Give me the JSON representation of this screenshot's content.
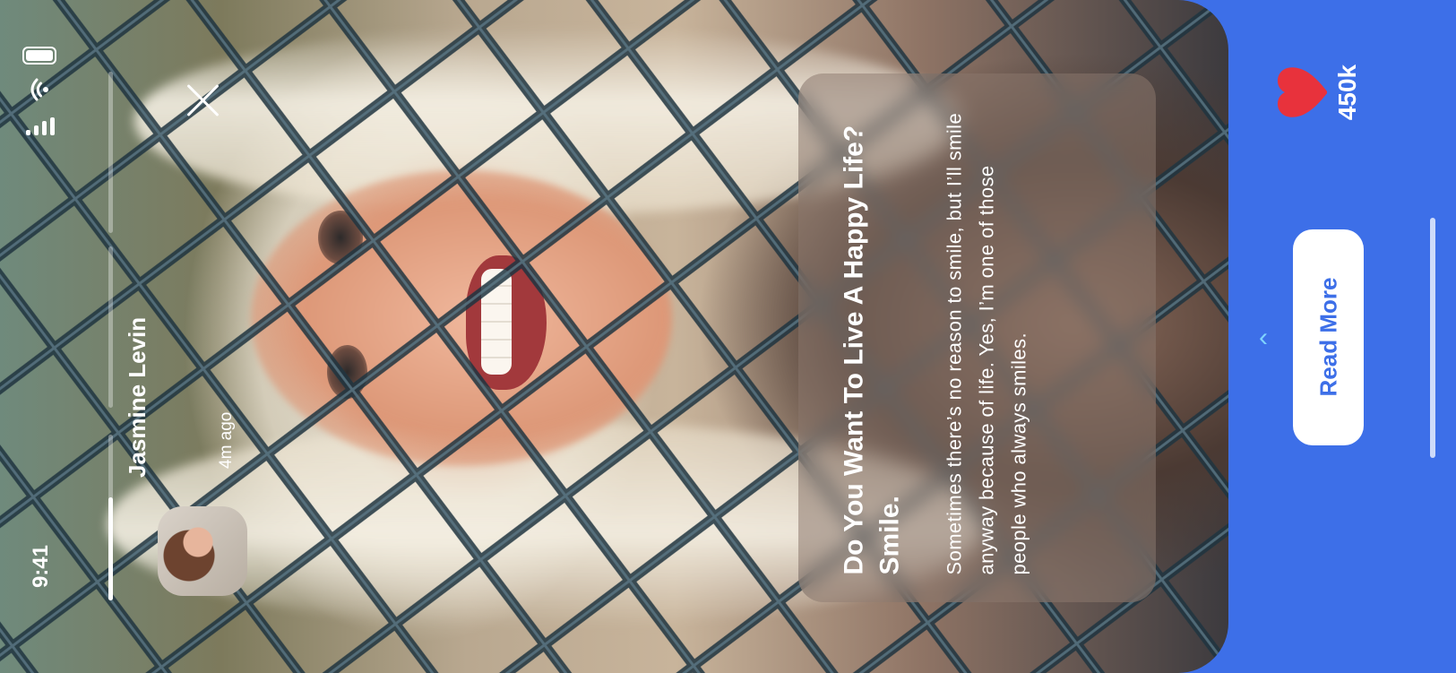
{
  "status_bar": {
    "time": "9:41"
  },
  "story": {
    "author_name": "Jasmine Levin",
    "posted_ago": "4m ago",
    "headline": "Do You Want To Live A Happy Life? Smile.",
    "body": "Sometimes there’s no reason to smile, but I’ll smile anyway because of life. Yes, I’m one of those people who always smiles.",
    "progress_segments": [
      0,
      0,
      0.62
    ]
  },
  "actions": {
    "likes": "450k",
    "read_more_label": "Read More"
  },
  "icons": {
    "close": "close-icon",
    "heart": "heart-icon",
    "chevron": "chevron-up-icon",
    "battery": "battery-icon",
    "wifi": "wifi-icon",
    "signal": "signal-icon"
  },
  "colors": {
    "accent": "#3d6fe8",
    "heart": "#e8323c",
    "chevron": "#7fd3ff"
  }
}
